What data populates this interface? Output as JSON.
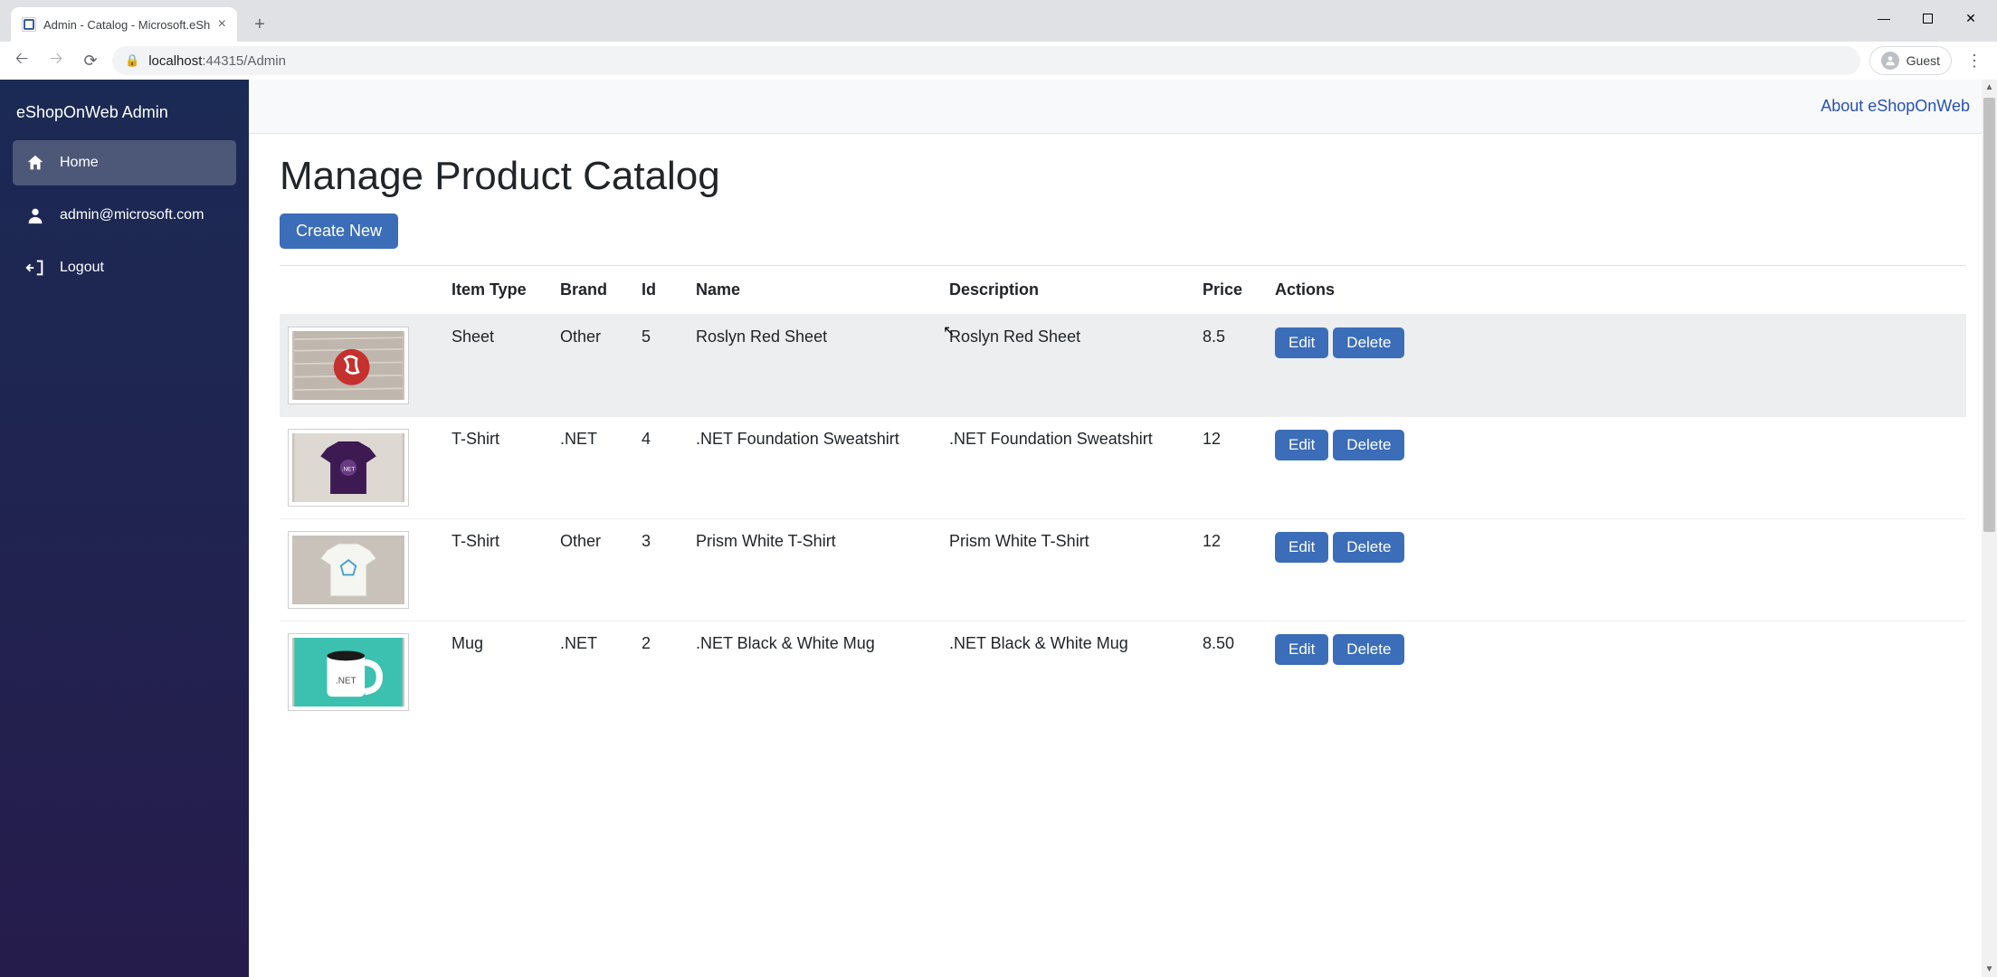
{
  "browser": {
    "tab_title": "Admin - Catalog - Microsoft.eSh",
    "url_host": "localhost",
    "url_port_path": ":44315/Admin",
    "guest_label": "Guest"
  },
  "sidebar": {
    "brand": "eShopOnWeb Admin",
    "items": [
      {
        "label": "Home",
        "icon": "home-icon",
        "active": true
      },
      {
        "label": "admin@microsoft.com",
        "icon": "user-icon",
        "active": false
      },
      {
        "label": "Logout",
        "icon": "logout-icon",
        "active": false
      }
    ]
  },
  "topbar": {
    "about_link": "About eShopOnWeb"
  },
  "page": {
    "title": "Manage Product Catalog",
    "create_label": "Create New"
  },
  "table": {
    "headers": [
      "",
      "Item Type",
      "Brand",
      "Id",
      "Name",
      "Description",
      "Price",
      "Actions"
    ],
    "edit_label": "Edit",
    "delete_label": "Delete",
    "rows": [
      {
        "item_type": "Sheet",
        "brand": "Other",
        "id": "5",
        "name": "Roslyn Red Sheet",
        "description": "Roslyn Red Sheet",
        "price": "8.5",
        "highlight": true
      },
      {
        "item_type": "T-Shirt",
        "brand": ".NET",
        "id": "4",
        "name": ".NET Foundation Sweatshirt",
        "description": ".NET Foundation Sweatshirt",
        "price": "12",
        "highlight": false
      },
      {
        "item_type": "T-Shirt",
        "brand": "Other",
        "id": "3",
        "name": "Prism White T-Shirt",
        "description": "Prism White T-Shirt",
        "price": "12",
        "highlight": false
      },
      {
        "item_type": "Mug",
        "brand": ".NET",
        "id": "2",
        "name": ".NET Black & White Mug",
        "description": ".NET Black & White Mug",
        "price": "8.50",
        "highlight": false
      }
    ]
  }
}
